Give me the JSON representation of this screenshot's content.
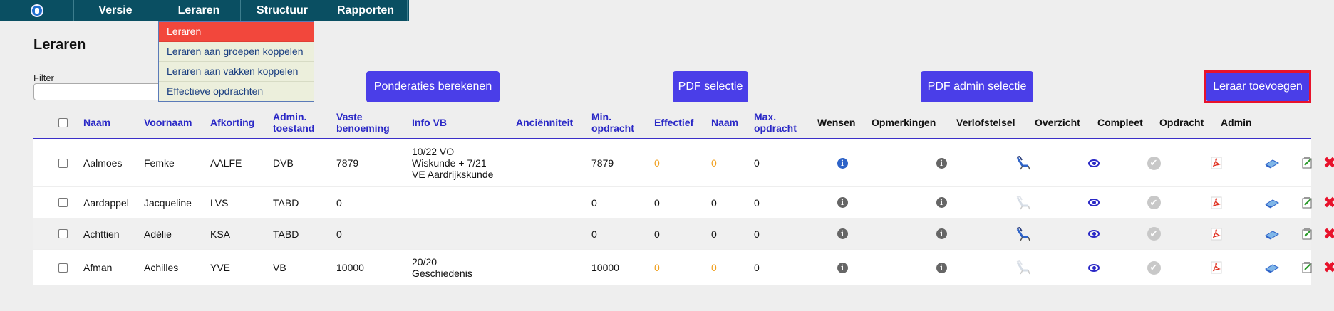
{
  "nav": {
    "items": [
      "Versie",
      "Leraren",
      "Structuur",
      "Rapporten"
    ]
  },
  "dropdown": {
    "items": [
      "Leraren",
      "Leraren aan groepen koppelen",
      "Leraren aan vakken koppelen",
      "Effectieve opdrachten"
    ]
  },
  "page": {
    "title": "Leraren",
    "filter_label": "Filter",
    "filter_value": ""
  },
  "buttons": {
    "ponderaties": "Ponderaties berekenen",
    "pdf": "PDF selectie",
    "pdf_admin": "PDF admin selectie",
    "add": "Leraar toevoegen"
  },
  "table": {
    "columns": {
      "naam": "Naam",
      "voornaam": "Voornaam",
      "afkorting": "Afkorting",
      "admin_toestand": "Admin.\ntoestand",
      "vaste_benoeming": "Vaste\nbenoeming",
      "info_vb": "Info VB",
      "ancienniteit": "Anciënniteit",
      "min_opdracht": "Min.\nopdracht",
      "effectief": "Effectief",
      "naam2": "Naam",
      "max_opdracht": "Max.\nopdracht",
      "wensen": "Wensen",
      "opmerkingen": "Opmerkingen",
      "verlofstelsel": "Verlofstelsel",
      "overzicht": "Overzicht",
      "compleet": "Compleet",
      "opdracht": "Opdracht",
      "admin": "Admin"
    },
    "rows": [
      {
        "naam": "Aalmoes",
        "voornaam": "Femke",
        "afkorting": "AALFE",
        "admin": "DVB",
        "vaste": "7879",
        "info": "10/22 VO\nWiskunde + 7/21\nVE Aardrijkskunde",
        "anc": "",
        "min": "7879",
        "eff": "0",
        "naam2": "0",
        "max": "0",
        "wensen_icon": "info-blue",
        "verlof_active": true
      },
      {
        "naam": "Aardappel",
        "voornaam": "Jacqueline",
        "afkorting": "LVS",
        "admin": "TABD",
        "vaste": "0",
        "info": "",
        "anc": "",
        "min": "0",
        "eff": "0",
        "naam2": "0",
        "max": "0",
        "wensen_icon": "info",
        "verlof_active": false
      },
      {
        "naam": "Achttien",
        "voornaam": "Adélie",
        "afkorting": "KSA",
        "admin": "TABD",
        "vaste": "0",
        "info": "",
        "anc": "",
        "min": "0",
        "eff": "0",
        "naam2": "0",
        "max": "0",
        "wensen_icon": "info",
        "verlof_active": true
      },
      {
        "naam": "Afman",
        "voornaam": "Achilles",
        "afkorting": "YVE",
        "admin": "VB",
        "vaste": "10000",
        "info": "20/20\nGeschiedenis",
        "anc": "",
        "min": "10000",
        "eff": "0",
        "naam2": "0",
        "max": "0",
        "wensen_icon": "info",
        "verlof_active": false
      }
    ]
  },
  "colors": {
    "nav_bg": "#0a4f62",
    "button": "#4a3ee8",
    "header_text": "#2a28c6",
    "highlight_border": "#e8122b",
    "orange_value": "#f0a020"
  }
}
